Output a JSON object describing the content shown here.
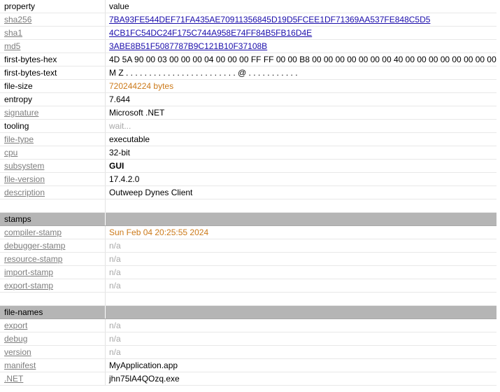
{
  "header": {
    "property": "property",
    "value": "value"
  },
  "rows": [
    {
      "key": "sha256",
      "value": "7BA93FE544DEF71FA435AE70911356845D19D5FCEE1DF71369AA537FE848C5D5"
    },
    {
      "key": "sha1",
      "value": "4CB1FC54DC24F175C744A958E74FF84B5FB16D4E"
    },
    {
      "key": "md5",
      "value": "3ABE8B51F5087787B9C121B10F37108B"
    },
    {
      "key": "first-bytes-hex",
      "value": "4D 5A 90 00 03 00 00 00 04 00 00 00 FF FF 00 00 B8 00 00 00 00 00 00 00 40 00 00 00 00 00 00 00 00"
    },
    {
      "key": "first-bytes-text",
      "value": "M Z . . . . . . . . . . . . . . . . . . . . . . . . @ . . . . . . . . . . ."
    },
    {
      "key": "file-size",
      "value": "720244224 bytes"
    },
    {
      "key": "entropy",
      "value": "7.644"
    },
    {
      "key": "signature",
      "value": "Microsoft .NET"
    },
    {
      "key": "tooling",
      "value": "wait..."
    },
    {
      "key": "file-type",
      "value": "executable"
    },
    {
      "key": "cpu",
      "value": "32-bit"
    },
    {
      "key": "subsystem",
      "value": "GUI"
    },
    {
      "key": "file-version",
      "value": "17.4.2.0"
    },
    {
      "key": "description",
      "value": "Outweep Dynes Client"
    }
  ],
  "stamps": {
    "title": "stamps",
    "rows": [
      {
        "key": "compiler-stamp",
        "value": "Sun Feb 04 20:25:55 2024"
      },
      {
        "key": "debugger-stamp",
        "value": "n/a"
      },
      {
        "key": "resource-stamp",
        "value": "n/a"
      },
      {
        "key": "import-stamp",
        "value": "n/a"
      },
      {
        "key": "export-stamp",
        "value": "n/a"
      }
    ]
  },
  "file_names": {
    "title": "file-names",
    "rows": [
      {
        "key": "export",
        "value": "n/a"
      },
      {
        "key": "debug",
        "value": "n/a"
      },
      {
        "key": "version",
        "value": "n/a"
      },
      {
        "key": "manifest",
        "value": "MyApplication.app"
      },
      {
        "key": ".NET",
        "value": "jhn75lA4QOzq.exe"
      }
    ]
  },
  "colors": {
    "link": "#1a0dab",
    "orange": "#cc7a1a",
    "muted": "#a8a8a8",
    "section_bg": "#b5b5b5"
  }
}
